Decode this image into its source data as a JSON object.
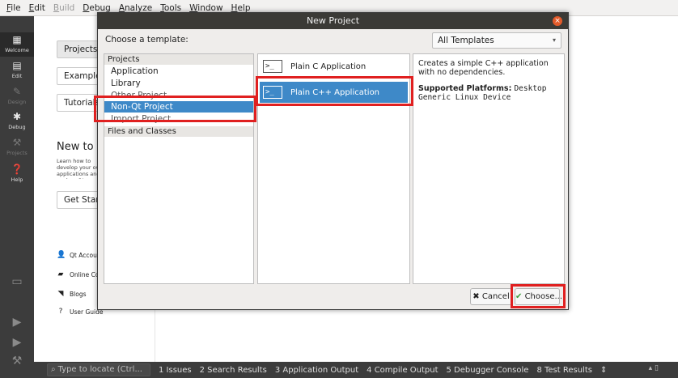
{
  "menubar": {
    "items": [
      {
        "label": "File",
        "ul": "F",
        "disabled": false
      },
      {
        "label": "Edit",
        "ul": "E",
        "disabled": false
      },
      {
        "label": "Build",
        "ul": "B",
        "disabled": true
      },
      {
        "label": "Debug",
        "ul": "D",
        "disabled": false
      },
      {
        "label": "Analyze",
        "ul": "A",
        "disabled": false
      },
      {
        "label": "Tools",
        "ul": "T",
        "disabled": false
      },
      {
        "label": "Window",
        "ul": "W",
        "disabled": false
      },
      {
        "label": "Help",
        "ul": "H",
        "disabled": false
      }
    ]
  },
  "modebar": {
    "items": [
      {
        "label": "Welcome",
        "icon": "grid-icon"
      },
      {
        "label": "Edit",
        "icon": "document-icon"
      },
      {
        "label": "Design",
        "icon": "pencil-icon"
      },
      {
        "label": "Debug",
        "icon": "bug-icon"
      },
      {
        "label": "Projects",
        "icon": "wrench-icon"
      },
      {
        "label": "Help",
        "icon": "help-icon"
      }
    ]
  },
  "welcome": {
    "projects_btn": "Projects",
    "examples_btn": "Examples",
    "tutorials_btn": "Tutorials",
    "new_to_title": "New to Q",
    "new_to_desc": "Learn how to develop your own applications and explore Qt Creator.",
    "get_started_btn": "Get Start",
    "links": [
      {
        "label": "Qt Accoun",
        "icon": "user-icon"
      },
      {
        "label": "Online Cor",
        "icon": "chat-icon"
      },
      {
        "label": "Blogs",
        "icon": "rss-icon"
      },
      {
        "label": "User Guide",
        "icon": "question-icon"
      }
    ]
  },
  "dialog": {
    "title": "New Project",
    "choose_label": "Choose a template:",
    "filter_value": "All Templates",
    "categories": {
      "projects_header": "Projects",
      "items": [
        "Application",
        "Library",
        "Other Project",
        "Non-Qt Project",
        "Import Project"
      ],
      "selected": "Non-Qt Project",
      "files_header": "Files and Classes"
    },
    "templates": [
      {
        "label": "Plain C Application",
        "icon": "terminal-icon",
        "selected": false
      },
      {
        "label": "Plain C++ Application",
        "icon": "terminal-icon",
        "selected": true
      }
    ],
    "description": {
      "text": "Creates a simple C++ application with no dependencies.",
      "platforms_label": "Supported Platforms",
      "platforms_value": "Desktop Generic Linux Device"
    },
    "cancel_label": "Cancel",
    "choose_label_btn": "Choose..."
  },
  "statusbar": {
    "locator_placeholder": "Type to locate (Ctrl...",
    "tabs": [
      "1 Issues",
      "2 Search Results",
      "3 Application Output",
      "4 Compile Output",
      "5 Debugger Console",
      "8 Test Results"
    ]
  },
  "colors": {
    "selection": "#3e89c8",
    "highlight": "#e02020",
    "sidebar": "#3c3c3c",
    "dialog_title": "#3b3a36"
  }
}
